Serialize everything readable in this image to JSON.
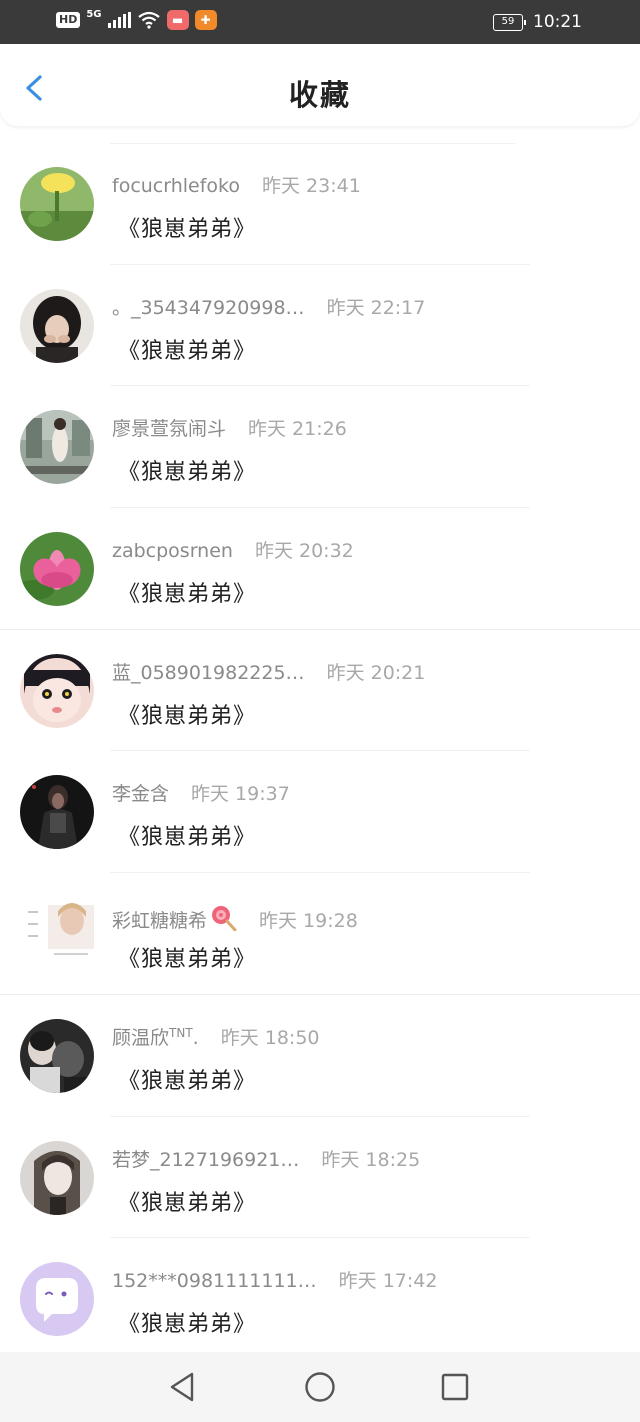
{
  "status_bar": {
    "hd": "HD",
    "network": "5G",
    "battery": "59",
    "time": "10:21"
  },
  "header": {
    "title": "收藏",
    "back_icon": "chevron-left-icon"
  },
  "list": {
    "items": [
      {
        "name": "focucrhlefoko",
        "time": "昨天 23:41",
        "content": "《狼崽弟弟》"
      },
      {
        "name": "。_354347920998…",
        "time": "昨天 22:17",
        "content": "《狼崽弟弟》"
      },
      {
        "name": "廖景萱氛闹斗",
        "time": "昨天 21:26",
        "content": "《狼崽弟弟》"
      },
      {
        "name": "zabcposrnen",
        "time": "昨天 20:32",
        "content": "《狼崽弟弟》"
      },
      {
        "name": "蓝_058901982225…",
        "time": "昨天 20:21",
        "content": "《狼崽弟弟》"
      },
      {
        "name": "李金含",
        "time": "昨天 19:37",
        "content": "《狼崽弟弟》"
      },
      {
        "name": "彩虹糖糖希",
        "time": "昨天 19:28",
        "content": "《狼崽弟弟》"
      },
      {
        "name": "顾温欣",
        "name_suffix": "TNT",
        "name_tail": ".",
        "time": "昨天 18:50",
        "content": "《狼崽弟弟》"
      },
      {
        "name": "若梦_2127196921…",
        "time": "昨天 18:25",
        "content": "《狼崽弟弟》"
      },
      {
        "name": "152***0981111111…",
        "time": "昨天 17:42",
        "content": "《狼崽弟弟》"
      }
    ]
  },
  "nav": {
    "back": "triangle-back-icon",
    "home": "circle-home-icon",
    "recents": "square-recents-icon"
  },
  "colors": {
    "status_bar": "#3a3a3a",
    "accent": "#3a8ee6",
    "meta_text": "#8a8a8a"
  }
}
